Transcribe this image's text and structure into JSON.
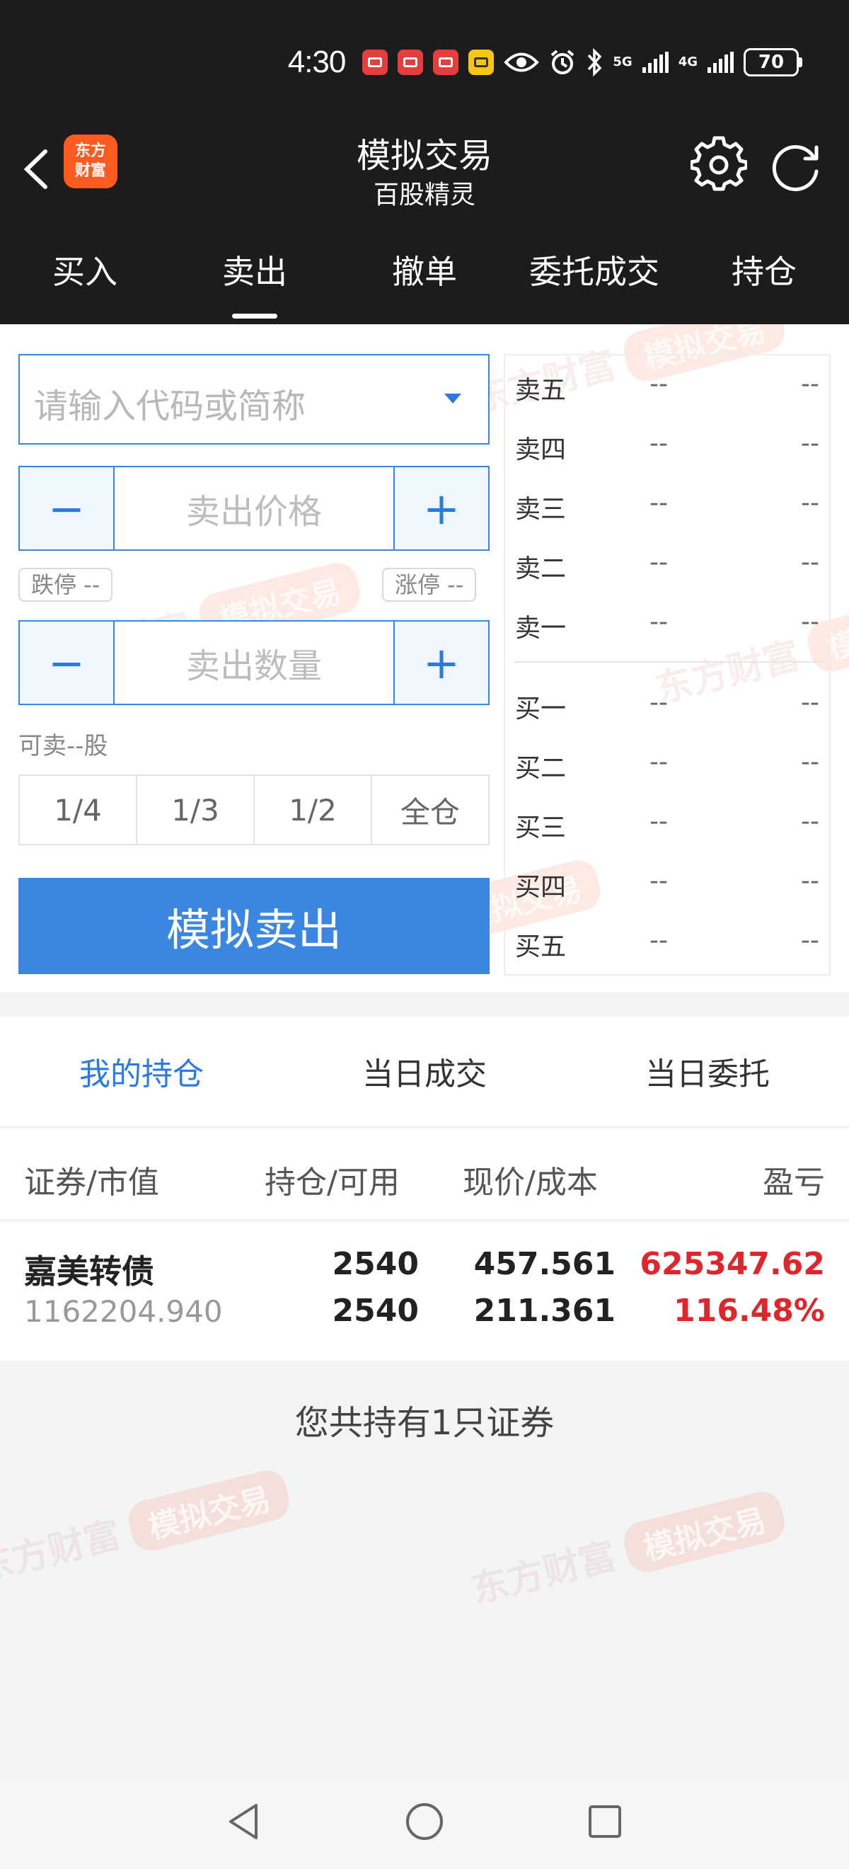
{
  "status": {
    "time": "4:30",
    "net_5g": "5G",
    "net_4g": "4G",
    "battery": "70"
  },
  "header": {
    "logo_line1": "东方",
    "logo_line2": "财富",
    "title": "模拟交易",
    "subtitle": "百股精灵"
  },
  "tabs": [
    "买入",
    "卖出",
    "撤单",
    "委托成交",
    "持仓"
  ],
  "form": {
    "code_placeholder": "请输入代码或简称",
    "price_placeholder": "卖出价格",
    "qty_placeholder": "卖出数量",
    "minus": "−",
    "plus": "+",
    "limit_down": "跌停 --",
    "limit_up": "涨停 --",
    "available": "可卖--股",
    "ratios": [
      "1/4",
      "1/3",
      "1/2",
      "全仓"
    ],
    "submit": "模拟卖出"
  },
  "order_book": {
    "asks": [
      {
        "label": "卖五",
        "price": "--",
        "volume": "--"
      },
      {
        "label": "卖四",
        "price": "--",
        "volume": "--"
      },
      {
        "label": "卖三",
        "price": "--",
        "volume": "--"
      },
      {
        "label": "卖二",
        "price": "--",
        "volume": "--"
      },
      {
        "label": "卖一",
        "price": "--",
        "volume": "--"
      }
    ],
    "bids": [
      {
        "label": "买一",
        "price": "--",
        "volume": "--"
      },
      {
        "label": "买二",
        "price": "--",
        "volume": "--"
      },
      {
        "label": "买三",
        "price": "--",
        "volume": "--"
      },
      {
        "label": "买四",
        "price": "--",
        "volume": "--"
      },
      {
        "label": "买五",
        "price": "--",
        "volume": "--"
      }
    ]
  },
  "holdings": {
    "tabs": [
      "我的持仓",
      "当日成交",
      "当日委托"
    ],
    "columns": [
      "证券/市值",
      "持仓/可用",
      "现价/成本",
      "盈亏"
    ],
    "rows": [
      {
        "name": "嘉美转债",
        "market_value": "1162204.940",
        "position": "2540",
        "available": "2540",
        "price": "457.561",
        "cost": "211.361",
        "pnl": "625347.62",
        "pnl_pct": "116.48%"
      }
    ],
    "summary": "您共持有1只证券"
  },
  "watermark": {
    "brand": "东方财富",
    "tag": "模拟交易"
  },
  "colors": {
    "accent": "#3a86e0",
    "header_bg": "#1c1c1c",
    "loss_gain_red": "#e0262d",
    "logo_orange": "#ff5a1f"
  },
  "icons": [
    "back-chevron-icon",
    "gear-icon",
    "refresh-icon",
    "eye-icon",
    "alarm-icon",
    "bluetooth-icon",
    "signal-icon",
    "battery-icon",
    "nav-back-icon",
    "nav-home-icon",
    "nav-recents-icon"
  ]
}
